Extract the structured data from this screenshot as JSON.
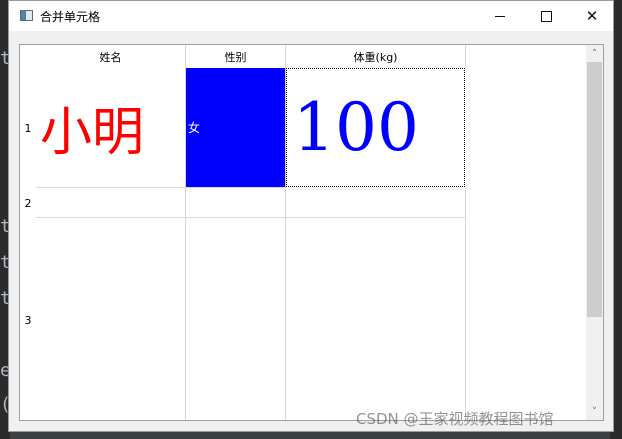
{
  "window": {
    "title": "合并单元格",
    "icon": "qt-app-window-icon",
    "controls": [
      "minimize-icon",
      "maximize-icon",
      "close-icon"
    ],
    "close_glyph": "✕"
  },
  "background_code": [
    "t",
    "t",
    "t",
    "t",
    "e",
    "("
  ],
  "table": {
    "columns": [
      "姓名",
      "性别",
      "体重(kg)"
    ],
    "row_headers": [
      "1",
      "2",
      "3"
    ],
    "cells": {
      "name": {
        "text": "小明",
        "color": "#ff0000"
      },
      "gender": {
        "text": "女",
        "background": "#0000ff",
        "color": "#ffffff"
      },
      "weight": {
        "text": "100",
        "color": "#0000ff"
      }
    },
    "scrollbar": {
      "up_icon": "chevron-up-icon",
      "down_icon": "chevron-down-icon",
      "up": "˄",
      "down": "˅"
    }
  },
  "watermark": "CSDN @王家视频教程图书馆"
}
